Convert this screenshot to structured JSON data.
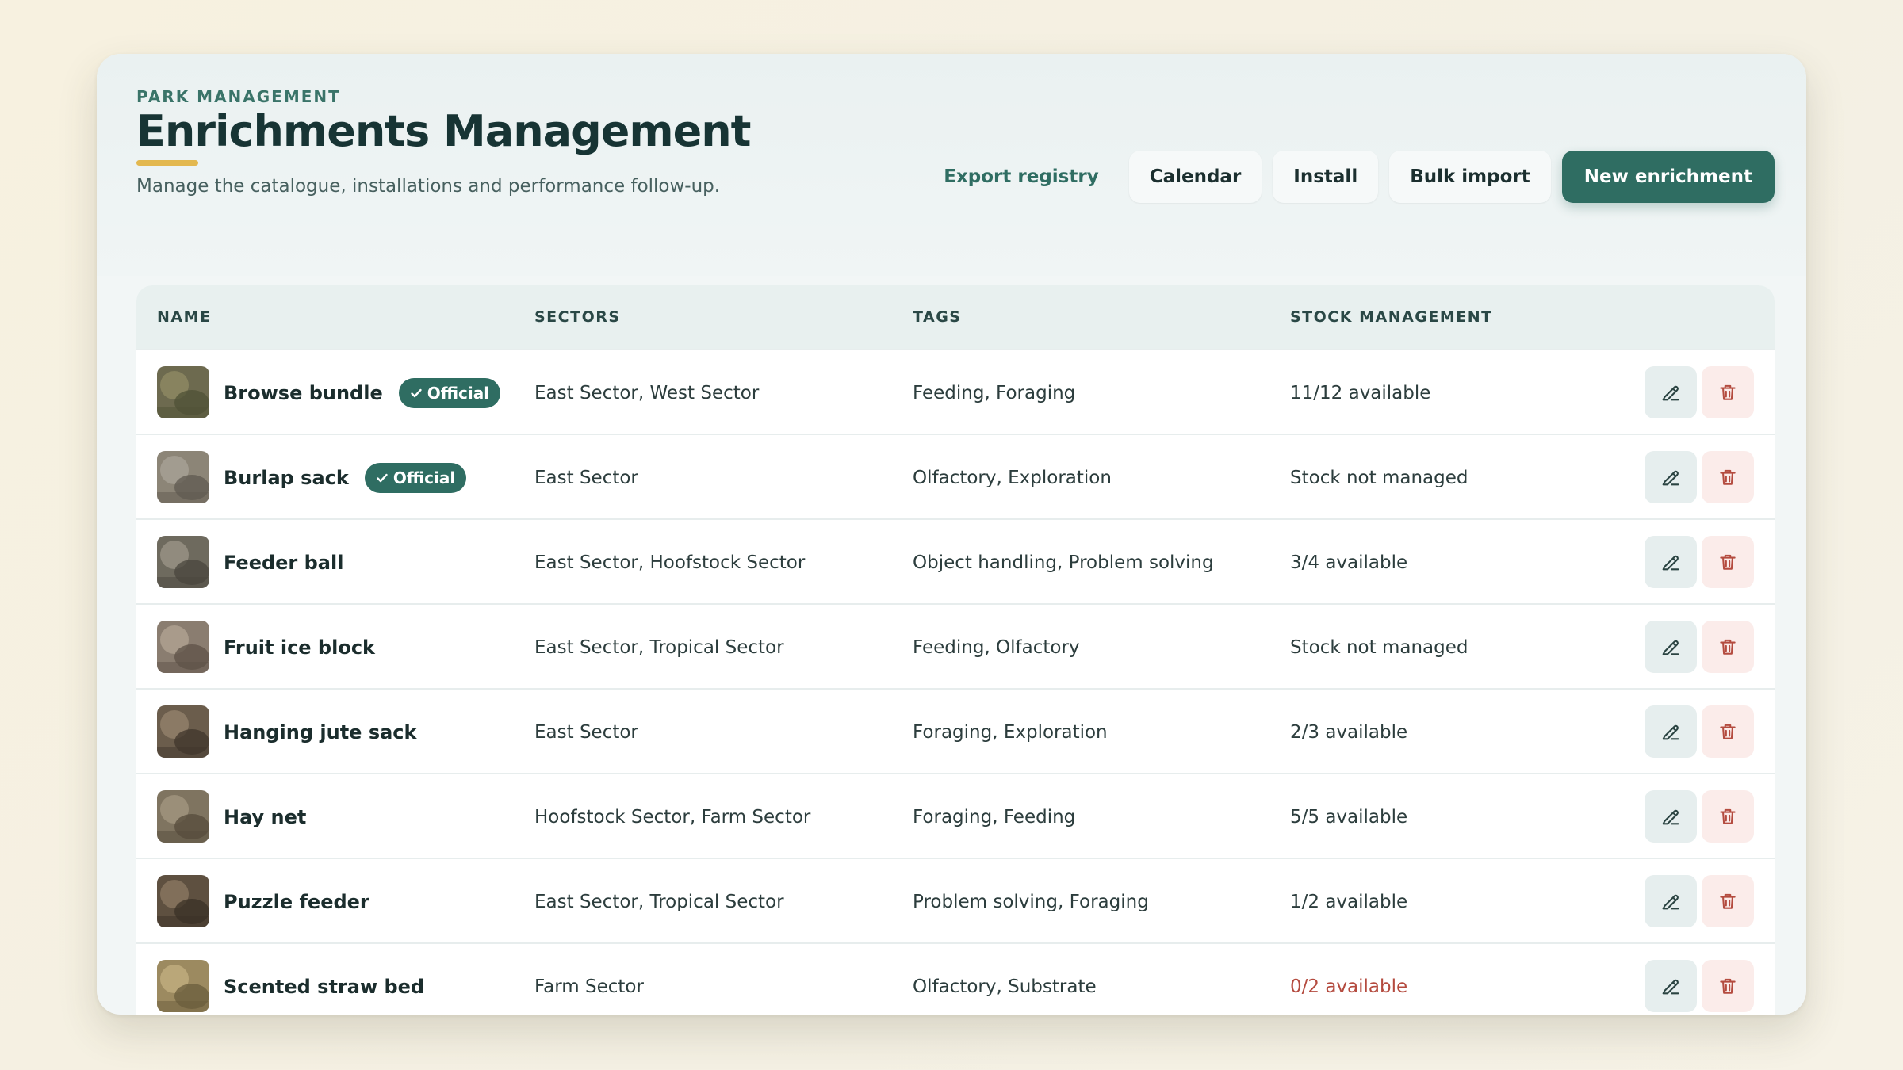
{
  "header": {
    "eyebrow": "PARK MANAGEMENT",
    "title": "Enrichments Management",
    "subtitle": "Manage the catalogue, installations and performance follow-up."
  },
  "actions": {
    "export": "Export registry",
    "calendar": "Calendar",
    "install": "Install",
    "bulk_import": "Bulk import",
    "new": "New enrichment"
  },
  "table": {
    "columns": {
      "name": "NAME",
      "sectors": "SECTORS",
      "tags": "TAGS",
      "stock": "STOCK MANAGEMENT"
    },
    "rows": [
      {
        "name": "Browse bundle",
        "badge": "Official",
        "sectors": "East Sector, West Sector",
        "tags": "Feeding, Foraging",
        "stock": "11/12 available"
      },
      {
        "name": "Burlap sack",
        "badge": "Official",
        "sectors": "East Sector",
        "tags": "Olfactory, Exploration",
        "stock": "Stock not managed"
      },
      {
        "name": "Feeder ball",
        "badge": "",
        "sectors": "East Sector, Hoofstock Sector",
        "tags": "Object handling, Problem solving",
        "stock": "3/4 available"
      },
      {
        "name": "Fruit ice block",
        "badge": "",
        "sectors": "East Sector, Tropical Sector",
        "tags": "Feeding, Olfactory",
        "stock": "Stock not managed"
      },
      {
        "name": "Hanging jute sack",
        "badge": "",
        "sectors": "East Sector",
        "tags": "Foraging, Exploration",
        "stock": "2/3 available"
      },
      {
        "name": "Hay net",
        "badge": "",
        "sectors": "Hoofstock Sector, Farm Sector",
        "tags": "Foraging, Feeding",
        "stock": "5/5 available"
      },
      {
        "name": "Puzzle feeder",
        "badge": "",
        "sectors": "East Sector, Tropical Sector",
        "tags": "Problem solving, Foraging",
        "stock": "1/2 available"
      },
      {
        "name": "Scented straw bed",
        "badge": "",
        "sectors": "Farm Sector",
        "tags": "Olfactory, Substrate",
        "stock": "0/2 available"
      }
    ]
  },
  "colors": {
    "accent": "#2f6d62",
    "underline": "#e3b84f",
    "danger": "#b44b3f"
  },
  "icons": {
    "badge": "check-icon",
    "edit": "pencil-icon",
    "delete": "trash-icon"
  }
}
